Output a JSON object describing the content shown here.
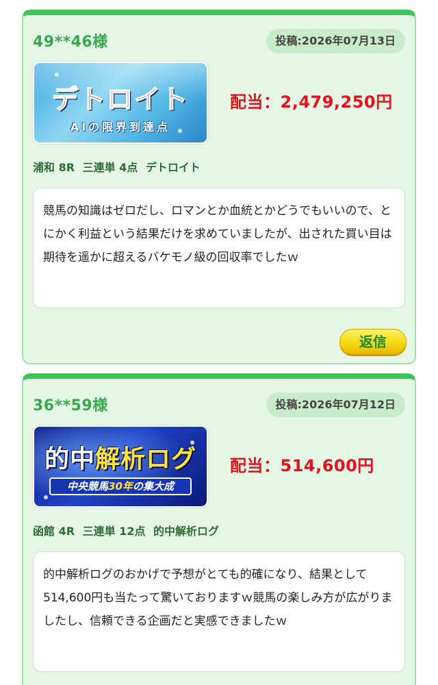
{
  "posts": [
    {
      "user": "49**46様",
      "date": "投稿:2026年07月13日",
      "banner": {
        "title": "デトロイト",
        "subtitle": "AIの限界到達点"
      },
      "payout": "配当：2,479,250円",
      "race": {
        "venue": "浦和 8R",
        "bet_type": "三連単 4点",
        "plan": "デトロイト"
      },
      "comment": "競馬の知識はゼロだし、ロマンとか血統とかどうでもいいので、とにかく利益という結果だけを求めていましたが、出された買い目は期待を遥かに超えるバケモノ級の回収率でしたｗ",
      "reply_label": "返信"
    },
    {
      "user": "36**59様",
      "date": "投稿:2026年07月12日",
      "banner": {
        "title_a": "的中",
        "title_b": "解析ログ",
        "subtitle_a": "中央競馬",
        "subtitle_b": "30年",
        "subtitle_c": "の集大成"
      },
      "payout": "配当：514,600円",
      "race": {
        "venue": "函館 4R",
        "bet_type": "三連単 12点",
        "plan": "的中解析ログ"
      },
      "comment": "的中解析ログのおかげで予想がとても的確になり、結果として514,600円も当たって驚いておりますｗ競馬の楽しみ方が広がりましたし、信頼できる企画だと実感できましたｗ"
    }
  ],
  "colors": {
    "card_bg": "#e3f7e4",
    "card_top": "#3fc457",
    "user": "#3aa84f",
    "payout": "#e5111e",
    "race": "#2f6b37",
    "reply_bg": "#f6d80f"
  }
}
